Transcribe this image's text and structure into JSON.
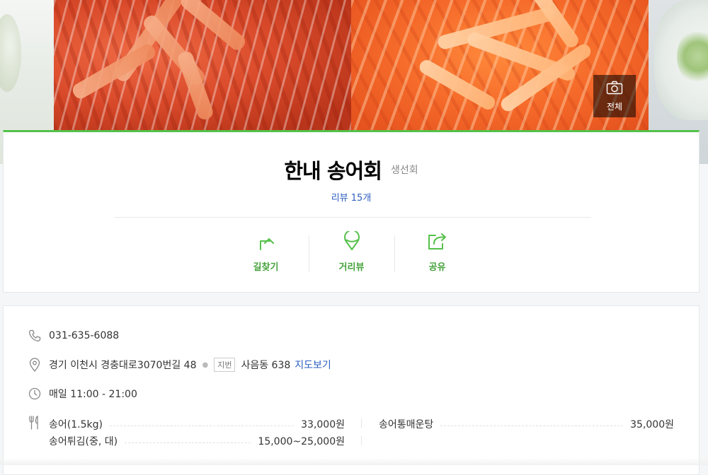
{
  "photos": {
    "all_label": "전체"
  },
  "place": {
    "name": "한내 송어회",
    "category": "생선회",
    "review_label": "리뷰 15개"
  },
  "actions": [
    {
      "label": "길찾기",
      "icon": "directions-icon"
    },
    {
      "label": "거리뷰",
      "icon": "street-view-icon"
    },
    {
      "label": "공유",
      "icon": "share-icon"
    }
  ],
  "info": {
    "phone": "031-635-6088",
    "address": "경기 이천시 경충대로3070번길 48",
    "jibun_badge": "지번",
    "jibun_address": "사음동 638",
    "map_link": "지도보기",
    "hours": "매일 11:00 - 21:00"
  },
  "menu": [
    {
      "name": "송어(1.5kg)",
      "price": "33,000원"
    },
    {
      "name": "송어통매운탕",
      "price": "35,000원"
    },
    {
      "name": "송어튀김(중, 대)",
      "price": "15,000~25,000원"
    }
  ],
  "colors": {
    "accent_green": "#54c14a",
    "action_text": "#44a23a",
    "link_blue": "#2d5fc1"
  }
}
